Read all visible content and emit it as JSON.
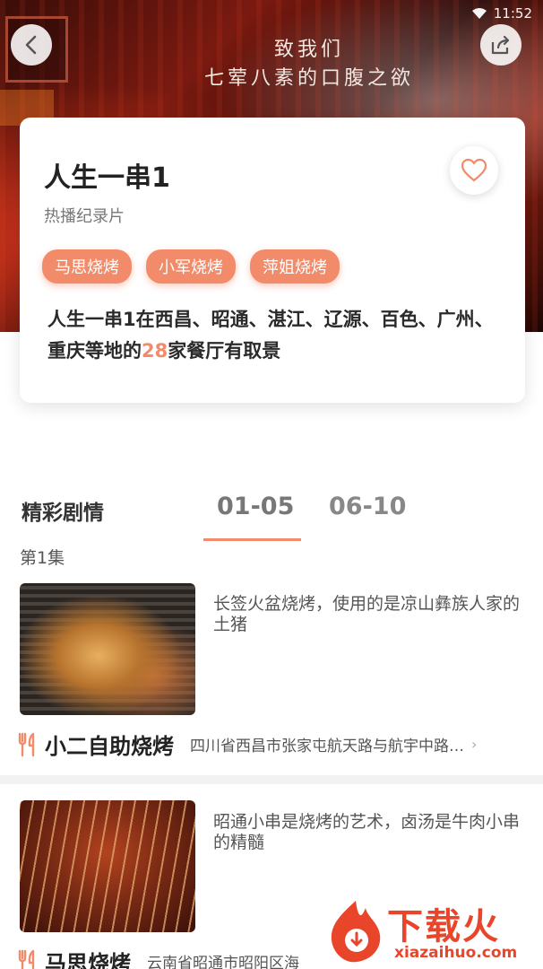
{
  "status": {
    "time": "11:52"
  },
  "hero": {
    "caption_line1": "致我们",
    "caption_line2": "七荤八素的口腹之欲"
  },
  "card": {
    "title": "人生一串1",
    "subtitle": "热播纪录片",
    "tags": [
      "马思烧烤",
      "小军烧烤",
      "萍姐烧烤"
    ],
    "desc_before": "人生一串1在西昌、昭通、湛江、辽源、百色、广州、重庆等地的",
    "desc_count": "28",
    "desc_after": "家餐厅有取景"
  },
  "episodes": {
    "section_title": "精彩剧情",
    "tabs": [
      "01-05",
      "06-10"
    ],
    "active_tab": 0,
    "episode_label": "第1集",
    "items": [
      {
        "text": "长签火盆烧烤，使用的是凉山彝族人家的土猪",
        "shop": "小二自助烧烤",
        "address": "四川省西昌市张家屯航天路与航宇中路…"
      },
      {
        "text": "昭通小串是烧烤的艺术，卤汤是牛肉小串的精髓",
        "shop": "马思烧烤",
        "address": "云南省昭通市昭阳区海"
      }
    ]
  },
  "watermark": {
    "brand": "下载火",
    "url": "xiazaihuo.com"
  },
  "colors": {
    "accent": "#f28b6a",
    "watermark": "#e8452b"
  }
}
